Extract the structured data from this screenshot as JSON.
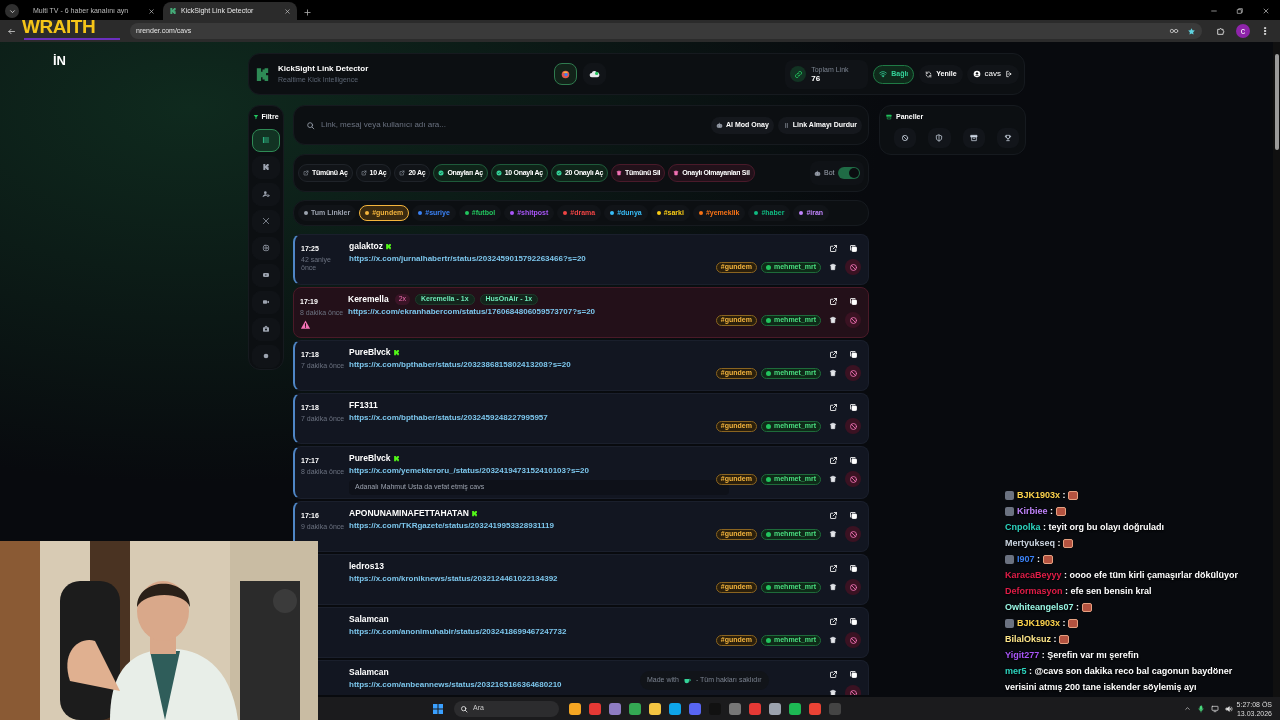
{
  "browser": {
    "tabs": [
      {
        "title": "Multi TV - 6 haber kanalını ayn",
        "selected": false
      },
      {
        "title": "KickSight Link Detector",
        "selected": true
      }
    ],
    "address": "nrender.com/cavs",
    "profile": "c"
  },
  "overlay": {
    "logo": "WRAITH",
    "corner_text": "İN"
  },
  "header": {
    "title": "KickSight Link Detector",
    "subtitle": "Realtime Kick Intelligence",
    "views": [
      {
        "kind": "globe",
        "selected": true
      },
      {
        "kind": "cloud",
        "selected": false
      }
    ],
    "stat_label": "Toplam Link",
    "stat_value": "76",
    "connection": "Bağlı",
    "refresh": "Yenile",
    "user": "cavs"
  },
  "sidebar": {
    "title": "Filtre",
    "items": [
      {
        "kind": "list",
        "selected": true
      },
      {
        "kind": "kick",
        "selected": false
      },
      {
        "kind": "user",
        "selected": false
      },
      {
        "kind": "x",
        "selected": false
      },
      {
        "kind": "instagram",
        "selected": false
      },
      {
        "kind": "youtube",
        "selected": false
      },
      {
        "kind": "video",
        "selected": false
      },
      {
        "kind": "camera",
        "selected": false
      },
      {
        "kind": "circle",
        "selected": false
      }
    ]
  },
  "search": {
    "placeholder": "Link, mesaj veya kullanıcı adı ara...",
    "buttons": [
      {
        "kind": "robot",
        "label": "AI Mod Onay"
      },
      {
        "kind": "pause",
        "label": "Link Almayı Durdur"
      }
    ]
  },
  "actions": [
    {
      "kind": "open",
      "label": "Tümünü Aç"
    },
    {
      "kind": "open",
      "label": "10 Aç"
    },
    {
      "kind": "open",
      "label": "20 Aç"
    },
    {
      "kind": "approved",
      "label": "Onayları Aç"
    },
    {
      "kind": "approved",
      "label": "10 Onaylı Aç"
    },
    {
      "kind": "approved",
      "label": "20 Onaylı Aç"
    },
    {
      "kind": "delete",
      "label": "Tümünü Sil"
    },
    {
      "kind": "delete",
      "label": "Onaylı Olmayanları Sil"
    }
  ],
  "bot": {
    "label": "Bot",
    "on": true
  },
  "filters": [
    {
      "label": "Tum Linkler",
      "color": "#9ca3af",
      "selected": false
    },
    {
      "label": "#gundem",
      "color": "#f5b53d",
      "selected": true
    },
    {
      "label": "#suriye",
      "color": "#3b82f6",
      "selected": false
    },
    {
      "label": "#futbol",
      "color": "#22c55e",
      "selected": false
    },
    {
      "label": "#shitpost",
      "color": "#a855f7",
      "selected": false
    },
    {
      "label": "#drama",
      "color": "#ef4444",
      "selected": false
    },
    {
      "label": "#dunya",
      "color": "#38bdf8",
      "selected": false
    },
    {
      "label": "#sarki",
      "color": "#facc15",
      "selected": false
    },
    {
      "label": "#yemeklik",
      "color": "#f97316",
      "selected": false
    },
    {
      "label": "#haber",
      "color": "#10b981",
      "selected": false
    },
    {
      "label": "#iran",
      "color": "#c084fc",
      "selected": false
    }
  ],
  "links": [
    {
      "time": "17:25",
      "ago": "42 saniye önce",
      "user": "galaktoz",
      "verified": true,
      "flagged": false,
      "url": "https://x.com/jurnalhabertr/status/2032459015792263466?s=20",
      "tag": "#gundem",
      "approver": "mehmet_mrt"
    },
    {
      "time": "17:19",
      "ago": "8 dakika önce",
      "user": "Keremella",
      "verified": false,
      "flagged": true,
      "count": "2x",
      "sources": [
        "Keremella - 1x",
        "HusOnAir - 1x"
      ],
      "url": "https://x.com/ekranhabercom/status/1760684806059573707?s=20",
      "tag": "#gundem",
      "approver": "mehmet_mrt"
    },
    {
      "time": "17:18",
      "ago": "7 dakika önce",
      "user": "PureBlvck",
      "verified": true,
      "flagged": false,
      "url": "https://x.com/bpthaber/status/2032386815802413208?s=20",
      "tag": "#gundem",
      "approver": "mehmet_mrt"
    },
    {
      "time": "17:18",
      "ago": "7 dakika önce",
      "user": "FF1311",
      "verified": false,
      "flagged": false,
      "url": "https://x.com/bpthaber/status/2032459248227995957",
      "tag": "#gundem",
      "approver": "mehmet_mrt"
    },
    {
      "time": "17:17",
      "ago": "8 dakika önce",
      "user": "PureBlvck",
      "verified": true,
      "flagged": false,
      "url": "https://x.com/yemekteroru_/status/2032419473152410103?s=20",
      "note": "Adanalı Mahmut Usta da vefat etmiş cavs",
      "tag": "#gundem",
      "approver": "mehmet_mrt"
    },
    {
      "time": "17:16",
      "ago": "9 dakika önce",
      "user": "APONUNAMINAFETTAHATAN",
      "verified": true,
      "flagged": false,
      "url": "https://x.com/TKRgazete/status/2032419953328931119",
      "tag": "#gundem",
      "approver": "mehmet_mrt"
    },
    {
      "user": "ledros13",
      "verified": false,
      "flagged": false,
      "url": "https://x.com/kroniknews/status/2032124461022134392",
      "tag": "#gundem",
      "approver": "mehmet_mrt"
    },
    {
      "user": "Salamcan",
      "verified": false,
      "flagged": false,
      "url": "https://x.com/anonimuhabir/status/2032418699467247732",
      "tag": "#gundem",
      "approver": "mehmet_mrt"
    },
    {
      "user": "Salamcan",
      "verified": false,
      "flagged": false,
      "url": "https://x.com/anbeannews/status/2032165166364680210"
    }
  ],
  "footer": {
    "before": "Made with",
    "after": "- Tüm hakları saklıdır"
  },
  "panels": {
    "title": "Paneller",
    "items": [
      {
        "kind": "block"
      },
      {
        "kind": "shield"
      },
      {
        "kind": "archive"
      },
      {
        "kind": "trophy"
      }
    ]
  },
  "chat": [
    {
      "user": "BJK1903x",
      "color": "#fcd34d",
      "badge": true,
      "text": ":",
      "emote": true
    },
    {
      "user": "Kirbiee",
      "color": "#c084fc",
      "badge": true,
      "text": ":",
      "emote": true
    },
    {
      "user": "Cnpolka",
      "color": "#2dd4bf",
      "text": ": teyit org bu olayı doğruladı"
    },
    {
      "user": "Mertyukseq",
      "color": "#cbd5e1",
      "text": ":",
      "emote": true
    },
    {
      "user": "I907",
      "color": "#3b82f6",
      "badge": true,
      "text": ":",
      "emote": true
    },
    {
      "user": "KaracaBeyyy",
      "color": "#e11d48",
      "text": ": oooo efe tüm kirli çamaşırlar dökülüyor"
    },
    {
      "user": "Deformasyon",
      "color": "#e11d48",
      "text": ": efe sen bensin kral"
    },
    {
      "user": "Owhiteangels07",
      "color": "#99f6e4",
      "text": ":",
      "emote": true
    },
    {
      "user": "BJK1903x",
      "color": "#fcd34d",
      "badge": true,
      "text": ":",
      "emote": true
    },
    {
      "user": "BilalOksuz",
      "color": "#fde68a",
      "text": ":",
      "emote": true
    },
    {
      "user": "Yigit277",
      "color": "#a855f7",
      "text": ": Şerefin var mı şerefin"
    },
    {
      "user": "mer5",
      "color": "#2dd4bf",
      "text": ": @cavs son dakika reco bal cagonun baydöner verisini atmış 200 tane iskender söylemiş ayı"
    }
  ],
  "taskbar": {
    "search": "Ara",
    "time": "5:27:08 ÖS",
    "date": "13.03.2026"
  }
}
